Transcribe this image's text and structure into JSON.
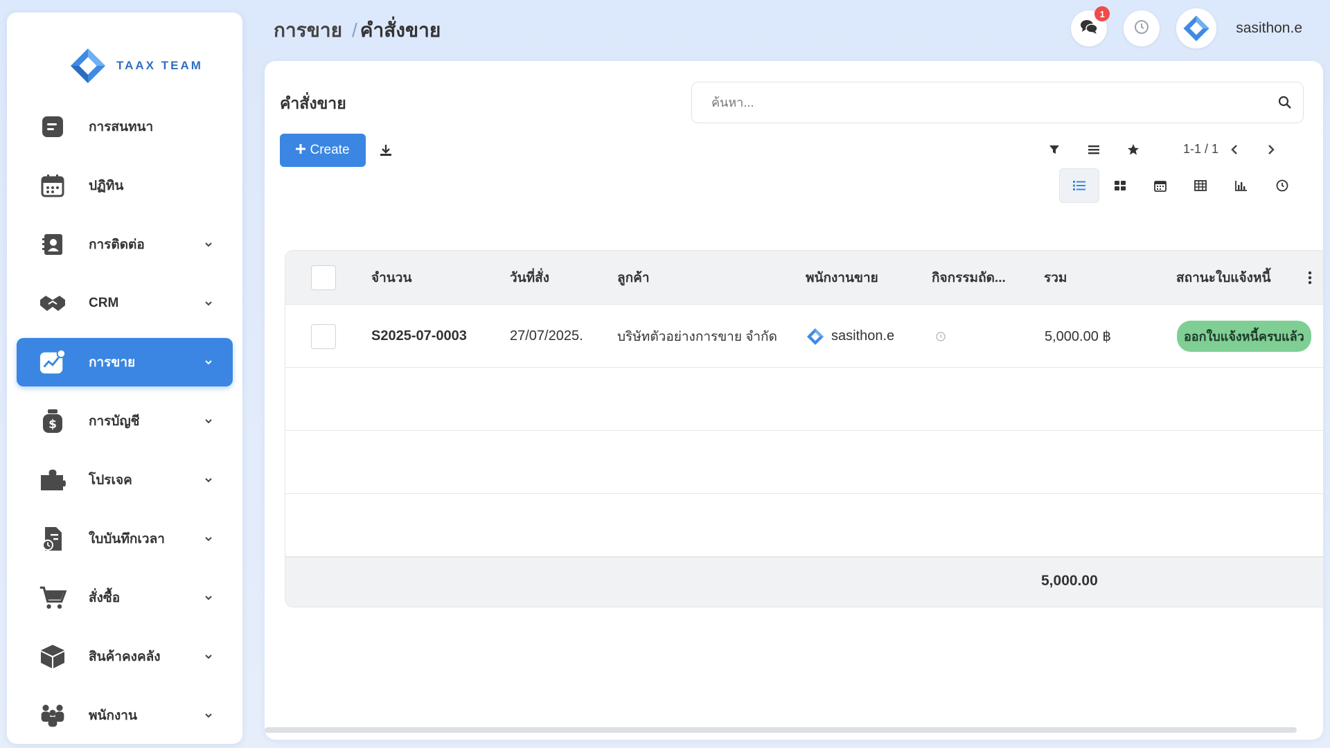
{
  "app": {
    "brand": "TAAX TEAM",
    "accent": "#3a86e2"
  },
  "breadcrumb": {
    "parent": "การขาย",
    "separator": "/",
    "current": "คำสั่งขาย"
  },
  "header": {
    "notification_count": "1",
    "username": "sasithon.e"
  },
  "sidebar": {
    "items": [
      {
        "label": "การสนทนา",
        "icon": "chat-icon",
        "expandable": false
      },
      {
        "label": "ปฏิทิน",
        "icon": "calendar-icon",
        "expandable": false
      },
      {
        "label": "การติดต่อ",
        "icon": "contact-book-icon",
        "expandable": true
      },
      {
        "label": "CRM",
        "icon": "handshake-icon",
        "expandable": true
      },
      {
        "label": "การขาย",
        "icon": "sales-chart-icon",
        "expandable": true,
        "active": true
      },
      {
        "label": "การบัญชี",
        "icon": "money-bag-icon",
        "expandable": true
      },
      {
        "label": "โปรเจค",
        "icon": "puzzle-icon",
        "expandable": true
      },
      {
        "label": "ใบบันทึกเวลา",
        "icon": "timesheet-icon",
        "expandable": true
      },
      {
        "label": "สั่งซื้อ",
        "icon": "cart-icon",
        "expandable": true
      },
      {
        "label": "สินค้าคงคลัง",
        "icon": "box-icon",
        "expandable": true
      },
      {
        "label": "พนักงาน",
        "icon": "people-icon",
        "expandable": true
      }
    ]
  },
  "main": {
    "title": "คำสั่งขาย",
    "search_placeholder": "ค้นหา...",
    "create_label": "Create",
    "pager": "1-1 / 1"
  },
  "table": {
    "columns": [
      "จำนวน",
      "วันที่สั่ง",
      "ลูกค้า",
      "พนักงานขาย",
      "กิจกรรมถัด...",
      "รวม",
      "สถานะใบแจ้งหนี้"
    ],
    "rows": [
      {
        "number": "S2025-07-0003",
        "date": "27/07/2025.",
        "customer": "บริษัทตัวอย่างการขาย จำกัด",
        "salesperson": "sasithon.e",
        "total": "5,000.00 ฿",
        "invoice_status": "ออกใบแจ้งหนี้ครบแล้ว"
      }
    ],
    "footer_total": "5,000.00"
  }
}
